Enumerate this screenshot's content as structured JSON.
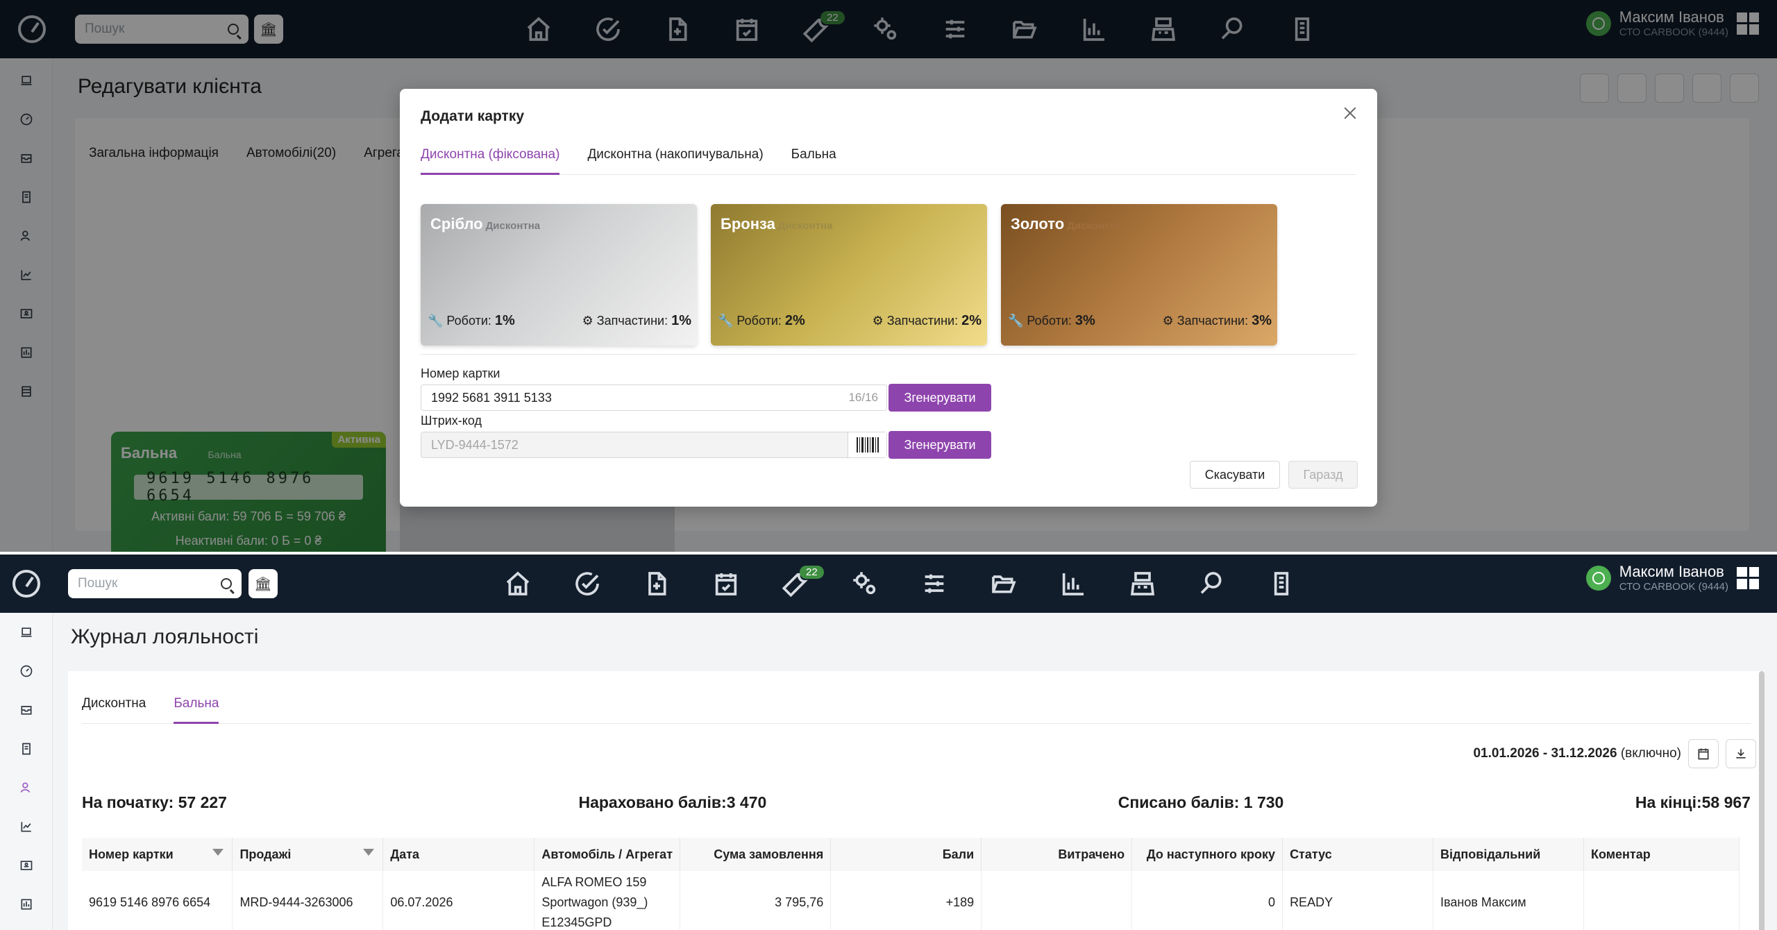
{
  "app": {
    "search_placeholder": "Пошук",
    "badge_count": "22",
    "user_name_top": "Максим Іванов",
    "user_name_bottom": "Максим Іванов",
    "company": "СТО CARBOOK (9444)"
  },
  "top_screen": {
    "title": "Редагувати клієнта",
    "tabs": [
      "Загальна інформація",
      "Автомобілі(20)",
      "Агрега"
    ],
    "loyalty_card": {
      "title": "Бальна",
      "type": "Бальна",
      "status": "Активна",
      "number": "9619 5146 8976 6654",
      "active_points": "Активні бали: 59 706 Б = 59 706 ₴",
      "inactive_points": "Неактивні бали: 0 Б = 0 ₴"
    }
  },
  "modal": {
    "title": "Додати картку",
    "tabs": [
      "Дисконтна (фіксована)",
      "Дисконтна (накопичувальна)",
      "Бальна"
    ],
    "cards": [
      {
        "name": "Срібло",
        "type": "Дисконтна",
        "works_label": "Роботи:",
        "works": "1%",
        "parts_label": "Запчастини:",
        "parts": "1%"
      },
      {
        "name": "Бронза",
        "type": "Дисконтна",
        "works_label": "Роботи:",
        "works": "2%",
        "parts_label": "Запчастини:",
        "parts": "2%"
      },
      {
        "name": "Золото",
        "type": "Дисконтна",
        "works_label": "Роботи:",
        "works": "3%",
        "parts_label": "Запчастини:",
        "parts": "3%"
      }
    ],
    "card_number_label": "Номер картки",
    "card_number_value": "1992 5681 3911 5133",
    "card_number_count": "16/16",
    "barcode_label": "Штрих-код",
    "barcode_placeholder": "LYD-9444-1572",
    "generate_label": "Згенерувати",
    "cancel_label": "Скасувати",
    "ok_label": "Гаразд"
  },
  "bottom_screen": {
    "title": "Журнал лояльності",
    "tabs": [
      "Дисконтна",
      "Бальна"
    ],
    "period_dates": "01.01.2026 - 31.12.2026",
    "period_note": "(включно)",
    "summary": {
      "start": "На початку: 57 227",
      "accrued": "Нараховано балів:3 470",
      "written_off": "Списано балів: 1 730",
      "end": "На кінці:58 967"
    },
    "columns": [
      "Номер картки",
      "Продажі",
      "Дата",
      "Автомобіль / Агрегат",
      "Сума замовлення",
      "Бали",
      "Витрачено",
      "До наступного кроку",
      "Статус",
      "Відповідальний",
      "Коментар"
    ],
    "rows": [
      {
        "card": "9619 5146 8976 6654",
        "sale": "MRD-9444-3263006",
        "date": "06.07.2026",
        "car_line1": "ALFA ROMEO 159",
        "car_line2": "Sportwagon (939_)",
        "car_line3": "E12345GPD",
        "amount": "3 795,76",
        "points": "+189",
        "spent": "",
        "next_step": "0",
        "status": "READY",
        "responsible": "Іванов Максим",
        "comment": ""
      }
    ]
  },
  "colors": {
    "accent": "#8e44ad",
    "navbar": "#121d2b",
    "green_card": "#3da44d"
  }
}
